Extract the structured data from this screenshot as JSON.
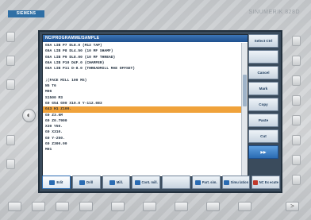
{
  "brand": {
    "left": "SIEMENS",
    "right": "SINUMERIK 828D"
  },
  "editor": {
    "title": "NC/PROGRAMME/SAMPLE",
    "lines": [
      "G6A LIB P7 DL8.0 (M12 TAP)",
      "G6A LIB P8 DL4.50 (10 MF SHAMF)",
      "G6A LIB P9 DL8.00 (10 MF THREAD)",
      "G6A LIB P10 D4F.0 (CHAMFER)",
      "G6A LIB P11 D-8.0 (THREADMILL MAE OFFSET)",
      "",
      ";(FACE MILL 100 MS)",
      "N5 T6",
      "M06",
      "S1500 M3",
      "G0 G54 G90 X10.0 Y-112.083",
      "G43 H1 Z100.",
      "G0 Z3.0M",
      "G0 Z0.7900",
      "X30 Y50.",
      "G0 X310.",
      "G0 Y-250.",
      "G0 Z300.00",
      "M01"
    ],
    "selected_index": 11
  },
  "vkeys": [
    {
      "label": "Select Ctrl",
      "style": "normal"
    },
    {
      "label": "",
      "style": "normal"
    },
    {
      "label": "Cancel",
      "style": "normal"
    },
    {
      "label": "Mark",
      "style": "normal"
    },
    {
      "label": "Copy",
      "style": "normal"
    },
    {
      "label": "Paste",
      "style": "normal"
    },
    {
      "label": "Cut",
      "style": "normal"
    },
    {
      "label": "▶▶",
      "style": "blue"
    }
  ],
  "hkeys": [
    {
      "label": "Edit",
      "active": true,
      "icon": "edit-icon"
    },
    {
      "label": "Drill",
      "active": false,
      "icon": "drill-icon"
    },
    {
      "label": "Mill.",
      "active": false,
      "icon": "mill-icon"
    },
    {
      "label": "Cont. mill.",
      "active": false,
      "icon": "contour-mill-icon"
    },
    {
      "label": "",
      "active": false,
      "icon": ""
    },
    {
      "label": "Part. sim.",
      "active": false,
      "icon": "simulation-icon"
    },
    {
      "label": "Simu lation",
      "active": false,
      "icon": "simulation-icon"
    },
    {
      "label": "NC Ex ecute",
      "active": false,
      "icon": "execute-icon"
    }
  ]
}
